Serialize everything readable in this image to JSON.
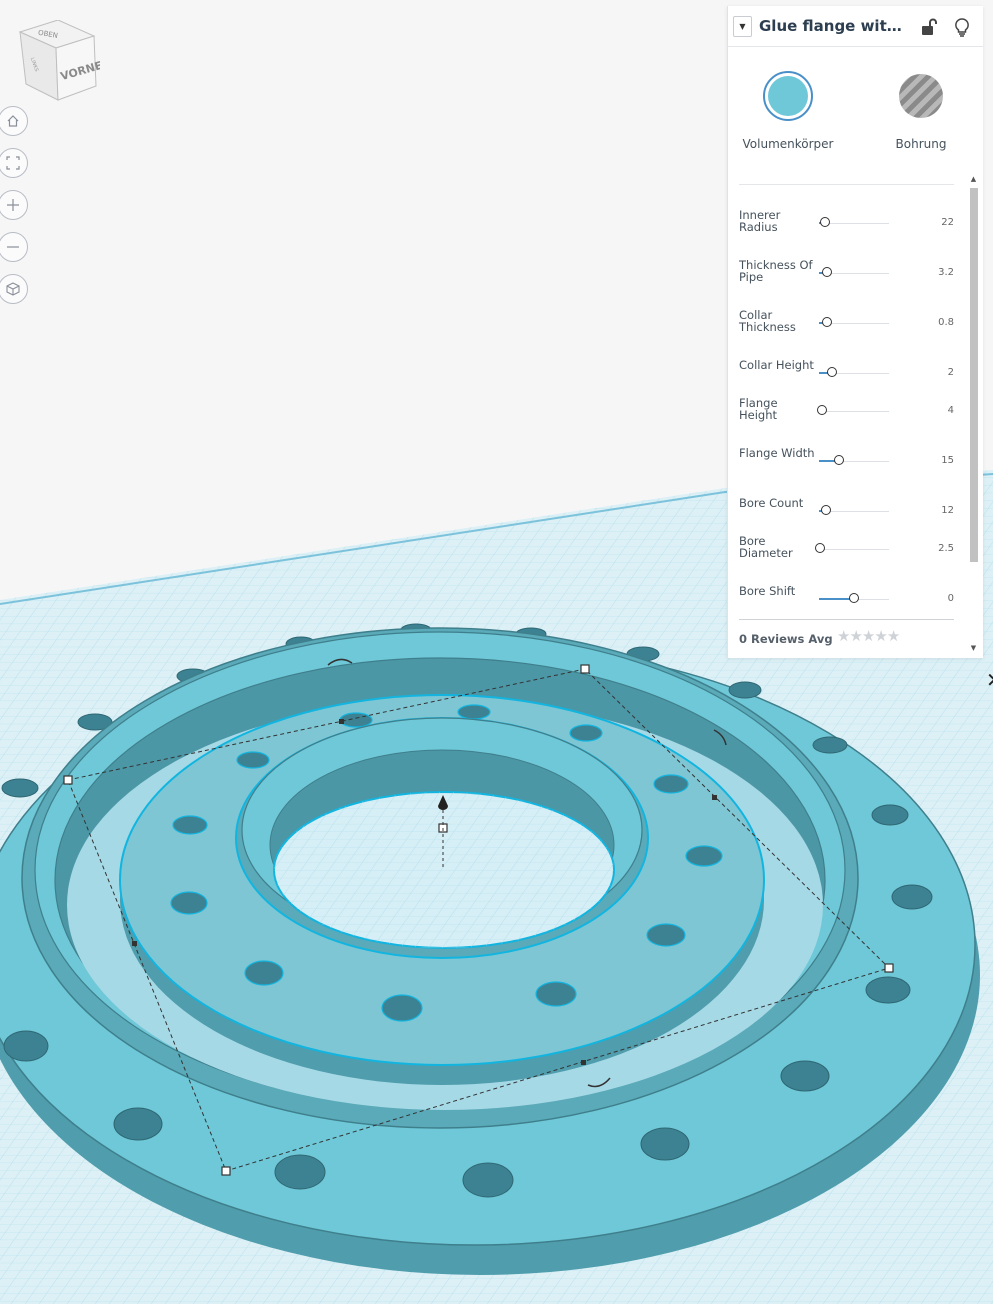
{
  "viewcube": {
    "top_label": "OBEN",
    "front_label": "VORNE",
    "left_label": "LINKS"
  },
  "nav": {
    "home_icon": "home-icon",
    "fit_icon": "fit-view-icon",
    "zoom_in_icon": "zoom-in-icon",
    "zoom_out_icon": "zoom-out-icon",
    "projection_icon": "perspective-cube-icon"
  },
  "panel": {
    "title": "Glue flange with bo...",
    "shape_types": [
      {
        "label": "Volumenkörper",
        "color": "#6ec8d8",
        "selected": true
      },
      {
        "label": "Bohrung",
        "color": "#9a9a9a",
        "selected": false
      }
    ],
    "params": [
      {
        "label": "Innerer Radius",
        "value": "22",
        "level": 0.08
      },
      {
        "label": "Thickness Of Pipe",
        "value": "3.2",
        "level": 0.12
      },
      {
        "label": "Collar Thickness",
        "value": "0.8",
        "level": 0.12
      },
      {
        "label": "Collar Height",
        "value": "2",
        "level": 0.18
      },
      {
        "label": "Flange Height",
        "value": "4",
        "level": 0.04
      },
      {
        "label": "Flange Width",
        "value": "15",
        "level": 0.28
      },
      {
        "label": "Bore Count",
        "value": "12",
        "level": 0.1
      },
      {
        "label": "Bore Diameter",
        "value": "2.5",
        "level": 0.02
      },
      {
        "label": "Bore Shift",
        "value": "0",
        "level": 0.5
      }
    ],
    "reviews_label": "0 Reviews Avg",
    "rating": 0,
    "rating_max": 5
  },
  "colors": {
    "model": "#6ec8d8",
    "model_dark": "#4c97a6",
    "model_side": "#5aaab9",
    "grid": "#a9dbeb",
    "grid_bg": "#dcf0f6",
    "accent": "#4a90c8"
  }
}
